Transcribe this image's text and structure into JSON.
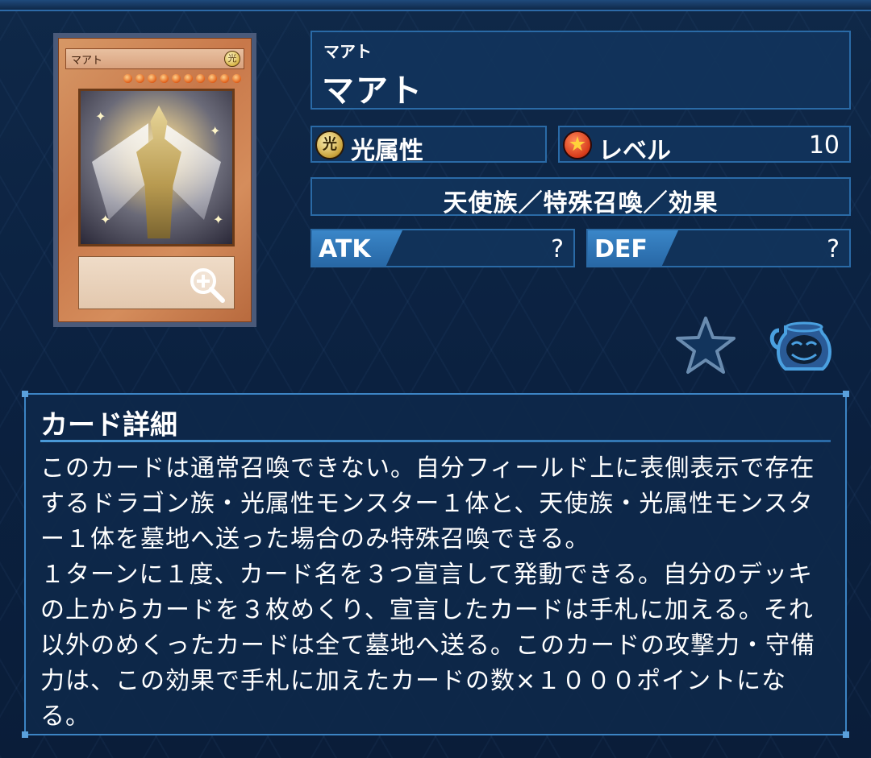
{
  "card": {
    "image_name": "マアト",
    "image_attribute_glyph": "光",
    "image_star_count": 10
  },
  "monster": {
    "name_ruby": "マアト",
    "name": "マアト",
    "attribute": {
      "icon": "light-attribute-icon",
      "glyph": "光",
      "label": "光属性"
    },
    "level": {
      "icon": "level-star-icon",
      "label": "レベル",
      "value": "10"
    },
    "type_line": "天使族／特殊召喚／効果",
    "atk": {
      "label": "ATK",
      "value": "?"
    },
    "def": {
      "label": "DEF",
      "value": "?"
    }
  },
  "actions": {
    "favorite_icon": "star-icon",
    "deck_icon": "pot-of-greed-icon"
  },
  "detail": {
    "title": "カード詳細",
    "text": "このカードは通常召喚できない。自分フィールド上に表側表示で存在するドラゴン族・光属性モンスター１体と、天使族・光属性モンスター１体を墓地へ送った場合のみ特殊召喚できる。\n１ターンに１度、カード名を３つ宣言して発動できる。自分のデッキの上からカードを３枚めくり、宣言したカードは手札に加える。それ以外のめくったカードは全て墓地へ送る。このカードの攻撃力・守備力は、この効果で手札に加えたカードの数×１０００ポイントになる。"
  },
  "colors": {
    "background": "#0b2140",
    "panel": "#12345c",
    "panel_border": "#2a6aa6",
    "stat_tab": "#3a86c8"
  }
}
